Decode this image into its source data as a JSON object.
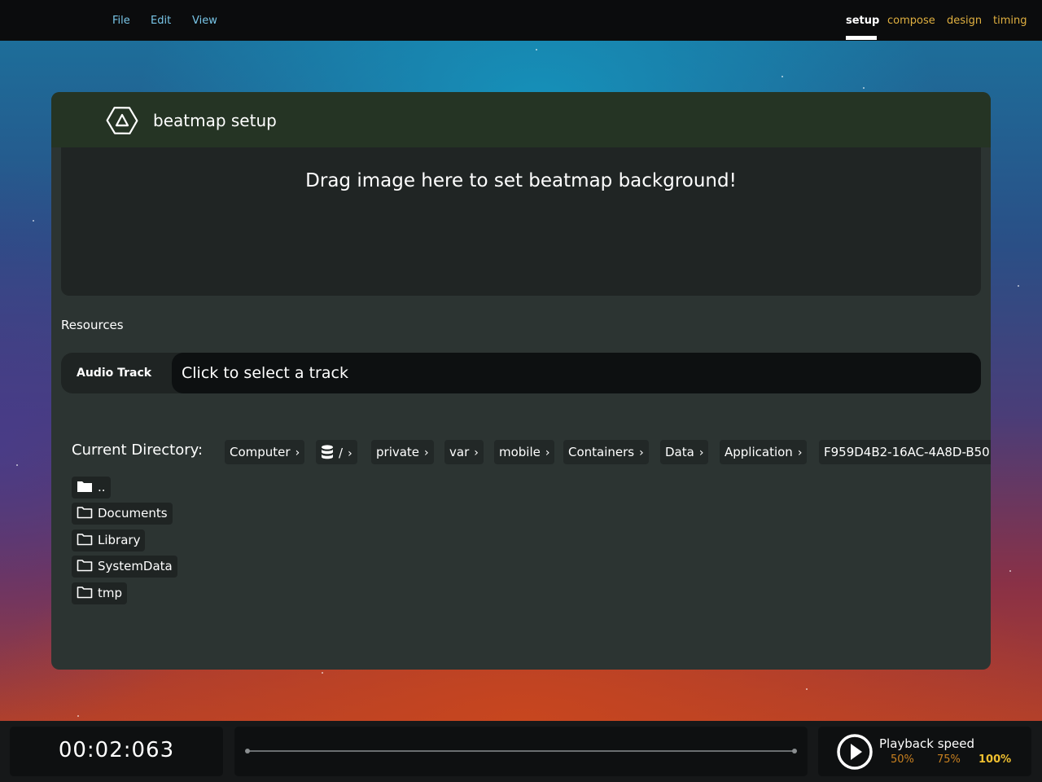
{
  "menu": {
    "items": [
      "File",
      "Edit",
      "View"
    ]
  },
  "modes": {
    "tabs": [
      "setup",
      "compose",
      "design",
      "timing"
    ],
    "active": "setup"
  },
  "panel": {
    "title": "beatmap setup",
    "background_drop_text": "Drag image here to set beatmap background!",
    "resources_label": "Resources",
    "audio_track_label": "Audio Track",
    "audio_track_value": "Click to select a track"
  },
  "file_browser": {
    "current_directory_label": "Current Directory:",
    "breadcrumb": [
      "Computer",
      "/",
      "private",
      "var",
      "mobile",
      "Containers",
      "Data",
      "Application",
      "F959D4B2-16AC-4A8D-B50"
    ],
    "entries": [
      "..",
      "Documents",
      "Library",
      "SystemData",
      "tmp"
    ]
  },
  "bottom_bar": {
    "time": "00:02:063",
    "playback_speed_label": "Playback speed",
    "speed_options": [
      "50%",
      "75%",
      "100%"
    ],
    "active_speed": "100%"
  },
  "colors": {
    "menu_text": "#79c6e8",
    "mode_tab": "#e0b040",
    "panel_bg": "#2c3432",
    "panel_header_bg": "#253424",
    "speed_active": "#f0c030"
  }
}
